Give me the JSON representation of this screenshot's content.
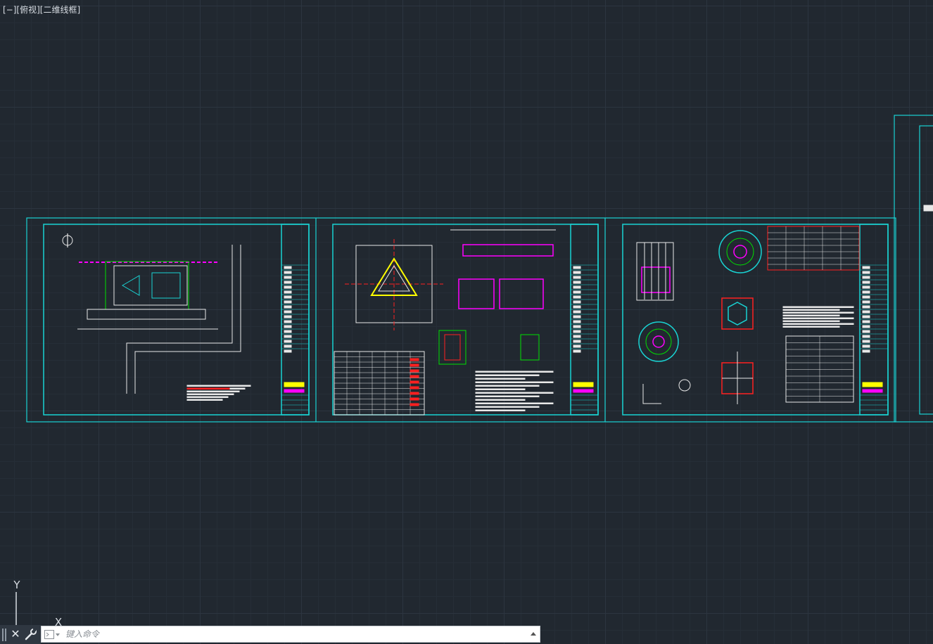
{
  "viewport": {
    "label": "[−][俯视][二维线框]"
  },
  "drawing": {
    "sheets": [
      {
        "name": "sheet-site-plan"
      },
      {
        "name": "sheet-foundation-plan"
      },
      {
        "name": "sheet-anchor-detail"
      },
      {
        "name": "sheet-partial-right"
      }
    ],
    "colors": {
      "frame": "#19d3d3",
      "annotation": "#ffff00",
      "highlight": "#ff00ff",
      "section": "#ff2020",
      "linework": "#e8e8e8",
      "axis": "#00e000"
    }
  },
  "ucs": {
    "y_label": "Y",
    "x_label": "X"
  },
  "command_line": {
    "placeholder": "键入命令"
  }
}
